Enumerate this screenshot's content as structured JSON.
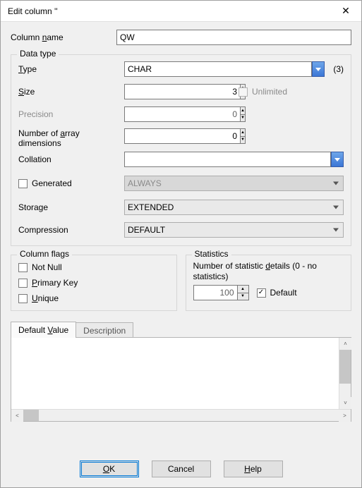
{
  "title": "Edit column ''",
  "columnName": {
    "label": "Column ",
    "u": "n",
    "rest": "ame",
    "value": "QW"
  },
  "dataType": {
    "legend": "Data type",
    "type": {
      "label": "",
      "u": "T",
      "rest": "ype",
      "value": "CHAR",
      "suffix": "(3)"
    },
    "size": {
      "u": "S",
      "rest": "ize",
      "value": "3"
    },
    "unlimited": "Unlimited",
    "precision": {
      "label": "Precision",
      "value": "0"
    },
    "array": {
      "pre": "Number of ",
      "u": "a",
      "rest": "rray dimensions",
      "value": "0"
    },
    "collation": {
      "label": "Collation",
      "value": ""
    },
    "generated": {
      "label": "Generated",
      "value": "ALWAYS"
    },
    "storage": {
      "label": "Storage",
      "value": "EXTENDED"
    },
    "compression": {
      "label": "Compression",
      "value": "DEFAULT"
    }
  },
  "flags": {
    "legend": "Column flags",
    "notnull": "Not Null",
    "pk": "rimary Key",
    "pk_u": "P",
    "unique": "nique",
    "unique_u": "U"
  },
  "stats": {
    "legend": "Statistics",
    "label_pre": "Number of statistic ",
    "label_u": "d",
    "label_rest": "etails (0 - no statistics)",
    "value": "100",
    "default": "Default"
  },
  "tabs": {
    "default_pre": "Default ",
    "default_u": "V",
    "default_rest": "alue",
    "desc": "Description"
  },
  "buttons": {
    "ok_u": "O",
    "ok_rest": "K",
    "cancel": "Cancel",
    "help_u": "H",
    "help_rest": "elp"
  }
}
